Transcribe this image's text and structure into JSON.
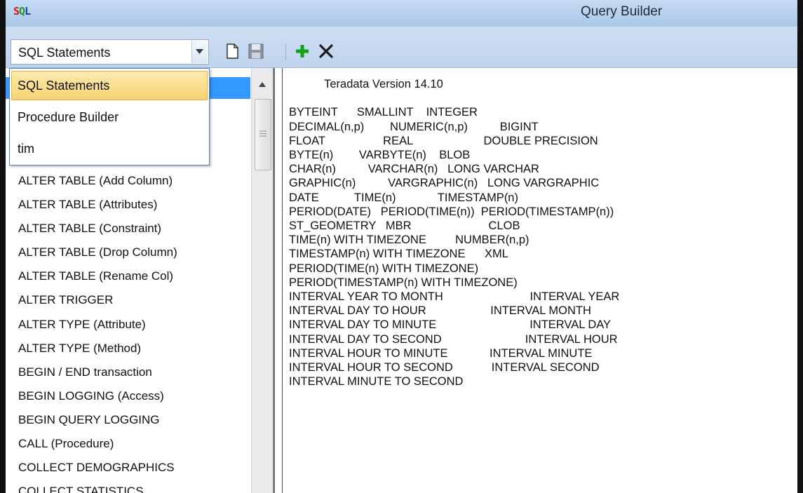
{
  "window": {
    "title": "Query Builder",
    "logo_letters": [
      "S",
      "Q",
      "L"
    ]
  },
  "toolbar": {
    "combo": {
      "selected": "SQL Statements",
      "options": [
        "SQL Statements",
        "Procedure Builder",
        "tim"
      ]
    },
    "buttons": [
      "new-document-icon",
      "save-icon",
      "add-icon",
      "delete-icon"
    ],
    "colors": {
      "add": "#16a016",
      "delete": "#1a1a1a"
    }
  },
  "sql_list": {
    "items": [
      "ALTER TABLE (Add Column)",
      "ALTER TABLE (Attributes)",
      "ALTER TABLE (Constraint)",
      "ALTER TABLE (Drop Column)",
      "ALTER TABLE (Rename Col)",
      "ALTER TRIGGER",
      "ALTER TYPE (Attribute)",
      "ALTER TYPE (Method)",
      "BEGIN / END transaction",
      "BEGIN LOGGING (Access)",
      "BEGIN QUERY LOGGING",
      "CALL (Procedure)",
      "COLLECT DEMOGRAPHICS",
      "COLLECT STATISTICS"
    ],
    "selection_color": "#3399ff"
  },
  "editor": {
    "text": "           Teradata Version 14.10\n\nBYTEINT      SMALLINT    INTEGER\nDECIMAL(n,p)        NUMERIC(n,p)          BIGINT\nFLOAT                  REAL                      DOUBLE PRECISION\nBYTE(n)        VARBYTE(n)    BLOB\nCHAR(n)          VARCHAR(n)   LONG VARCHAR\nGRAPHIC(n)          VARGRAPHIC(n)   LONG VARGRAPHIC\nDATE           TIME(n)             TIMESTAMP(n)\nPERIOD(DATE)   PERIOD(TIME(n))  PERIOD(TIMESTAMP(n))\nST_GEOMETRY   MBR                        CLOB\nTIME(n) WITH TIMEZONE         NUMBER(n,p)\nTIMESTAMP(n) WITH TIMEZONE      XML\nPERIOD(TIME(n) WITH TIMEZONE)\nPERIOD(TIMESTAMP(n) WITH TIMEZONE)\nINTERVAL YEAR TO MONTH                           INTERVAL YEAR\nINTERVAL DAY TO HOUR                    INTERVAL MONTH\nINTERVAL DAY TO MINUTE                             INTERVAL DAY\nINTERVAL DAY TO SECOND                          INTERVAL HOUR\nINTERVAL HOUR TO MINUTE             INTERVAL MINUTE\nINTERVAL HOUR TO SECOND            INTERVAL SECOND\nINTERVAL MINUTE TO SECOND"
  }
}
